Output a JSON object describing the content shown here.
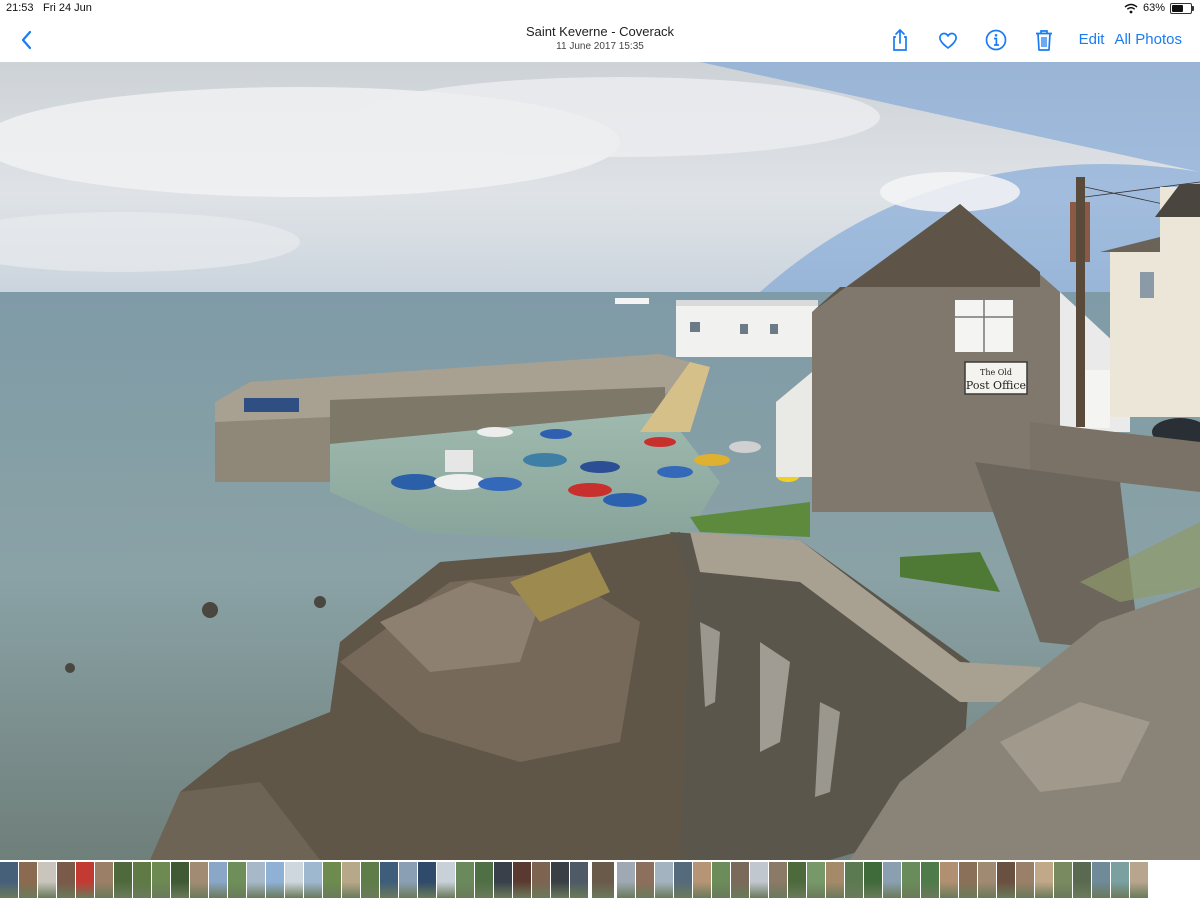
{
  "status_bar": {
    "time": "21:53",
    "date": "Fri 24 Jun",
    "battery_percent": "63%",
    "battery_level": 0.63
  },
  "nav": {
    "title": "Saint Keverne - Coverack",
    "subtitle": "11 June 2017  15:35",
    "edit_label": "Edit",
    "all_photos_label": "All Photos",
    "accent_color": "#1a7cf2",
    "icons": [
      "chevron-left-icon",
      "share-icon",
      "heart-icon",
      "info-icon",
      "trash-icon"
    ]
  },
  "photo": {
    "sign_line1": "The Old",
    "sign_line2": "Post Office"
  },
  "thumbnails": [
    "#46607a",
    "#8a6a50",
    "#c9c5bd",
    "#7a5a48",
    "#c33a32",
    "#9b7f66",
    "#4e6a3c",
    "#5f7a45",
    "#6d8a52",
    "#3f5a34",
    "#a18c73",
    "#8aa7c8",
    "#6f8f5a",
    "#a7b9c9",
    "#8fb1d6",
    "#cfd7de",
    "#9eb8cf",
    "#6d8b4f",
    "#b8a88a",
    "#5e7d49",
    "#3e5d7a",
    "#8a9fb3",
    "#2f4a6a",
    "#c8d0d8",
    "#6a8a5c",
    "#4f6f44",
    "#39404a",
    "#5a3a30",
    "#7c6450",
    "#3a3f45",
    "#4e5a66",
    "#6a5a4a",
    "#9ea9b4",
    "#8c6f5c",
    "#a3b3c0",
    "#556a7a",
    "#b59575",
    "#6c8c5a",
    "#7a6a5a",
    "#c0c7cf",
    "#8a7a66",
    "#4c6a3c",
    "#77996a",
    "#a58a6a",
    "#5c7a52",
    "#3f6a3a",
    "#8aa0b0",
    "#6a8c5a",
    "#4f7a4a",
    "#b09070",
    "#8a7058",
    "#a08a72",
    "#6a5040",
    "#9a8068",
    "#c0a888",
    "#7a8a60",
    "#5a6a50",
    "#6f8a99",
    "#7aa0a0",
    "#b8a58e"
  ],
  "current_thumb_index": 31
}
